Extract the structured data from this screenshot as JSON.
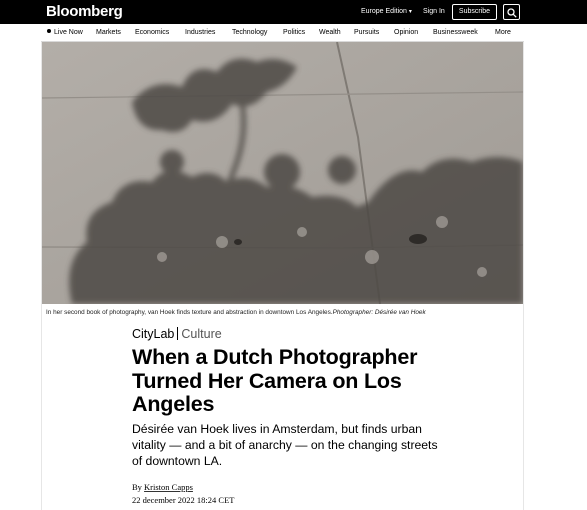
{
  "header": {
    "logo": "Bloomberg",
    "edition_label": "Europe Edition",
    "signin_label": "Sign In",
    "subscribe_label": "Subscribe"
  },
  "nav": {
    "items": [
      "Live Now",
      "Markets",
      "Economics",
      "Industries",
      "Technology",
      "Politics",
      "Wealth",
      "Pursuits",
      "Opinion",
      "Businessweek",
      "More"
    ]
  },
  "hero": {
    "caption": "In her second book of photography, van Hoek finds texture and abstraction in downtown Los Angeles.",
    "credit": "Photographer: Désirée van Hoek"
  },
  "article": {
    "brand": "CityLab",
    "section": "Culture",
    "headline": "When a Dutch Photographer Turned Her Camera on Los Angeles",
    "dek": "Désirée van Hoek lives in Amsterdam, but finds urban vitality — and a bit of anarchy — on the changing streets of downtown LA.",
    "byline_prefix": "By",
    "author": "Kriston Capps",
    "date": "22 december 2022 18:24 CET"
  }
}
